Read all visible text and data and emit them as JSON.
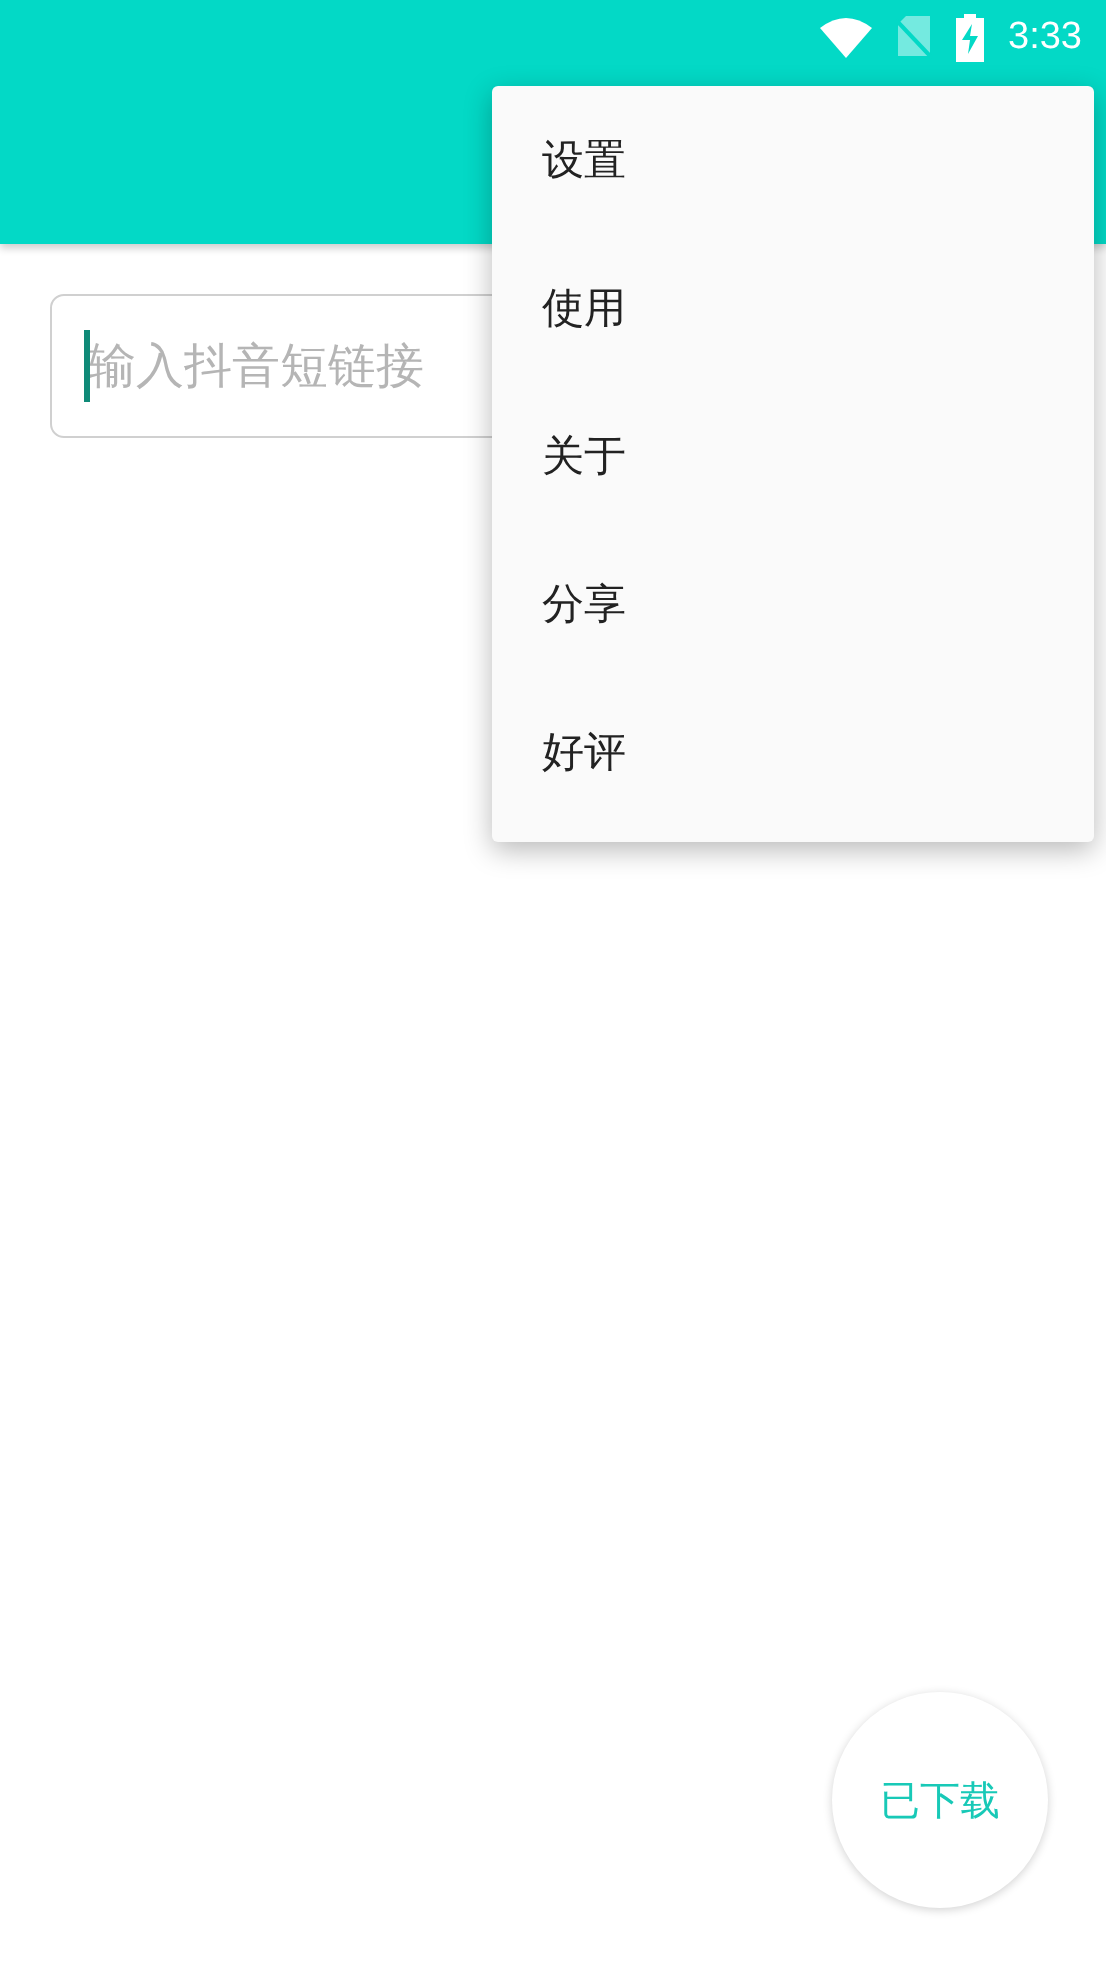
{
  "status_bar": {
    "time": "3:33"
  },
  "search": {
    "placeholder": "输入抖音短链接"
  },
  "menu": {
    "items": [
      {
        "label": "设置"
      },
      {
        "label": "使用"
      },
      {
        "label": "关于"
      },
      {
        "label": "分享"
      },
      {
        "label": "好评"
      }
    ]
  },
  "fab": {
    "label": "已下载"
  }
}
